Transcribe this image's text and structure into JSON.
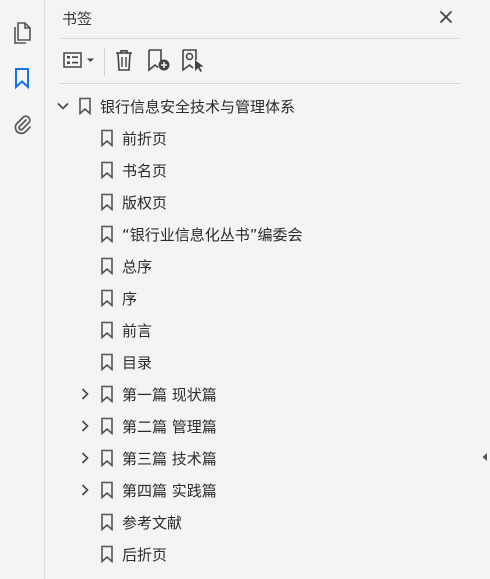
{
  "rail": {
    "items": [
      {
        "icon": "pages-icon",
        "active": false
      },
      {
        "icon": "bookmark-icon",
        "active": true
      },
      {
        "icon": "attachment-icon",
        "active": false
      }
    ]
  },
  "panel": {
    "title": "书签",
    "toolbar": {
      "options_icon": "list-options-icon",
      "delete_icon": "trash-icon",
      "new_bookmark_icon": "add-bookmark-icon",
      "find_bookmark_icon": "find-bookmark-icon"
    }
  },
  "bookmarks": [
    {
      "label": "银行信息安全技术与管理体系",
      "level": 0,
      "expander": "expanded"
    },
    {
      "label": "前折页",
      "level": 1,
      "expander": "none"
    },
    {
      "label": "书名页",
      "level": 1,
      "expander": "none"
    },
    {
      "label": "版权页",
      "level": 1,
      "expander": "none"
    },
    {
      "label": "“银行业信息化丛书”编委会",
      "level": 1,
      "expander": "none"
    },
    {
      "label": "总序",
      "level": 1,
      "expander": "none"
    },
    {
      "label": "序",
      "level": 1,
      "expander": "none"
    },
    {
      "label": "前言",
      "level": 1,
      "expander": "none"
    },
    {
      "label": "目录",
      "level": 1,
      "expander": "none"
    },
    {
      "label": "第一篇  现状篇",
      "level": 1,
      "expander": "collapsed"
    },
    {
      "label": "第二篇  管理篇",
      "level": 1,
      "expander": "collapsed"
    },
    {
      "label": "第三篇  技术篇",
      "level": 1,
      "expander": "collapsed"
    },
    {
      "label": "第四篇  实践篇",
      "level": 1,
      "expander": "collapsed"
    },
    {
      "label": "参考文献",
      "level": 1,
      "expander": "none"
    },
    {
      "label": "后折页",
      "level": 1,
      "expander": "none"
    }
  ],
  "colors": {
    "accent": "#1473e6",
    "icon": "#555555",
    "background": "#f4f4f4"
  }
}
